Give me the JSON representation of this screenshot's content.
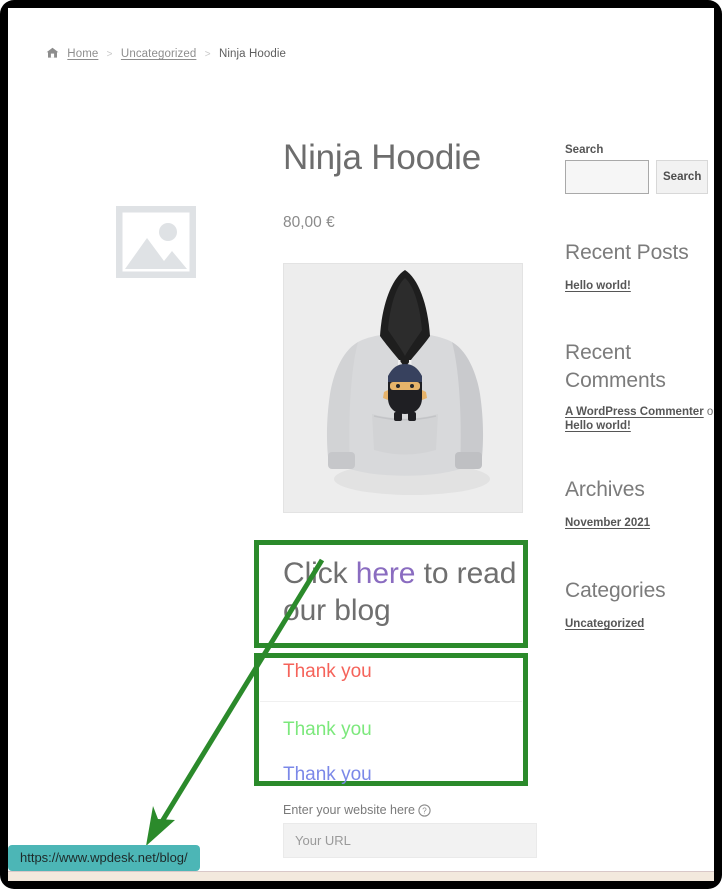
{
  "breadcrumb": {
    "home_icon": "home-icon",
    "items": [
      {
        "label": "Home",
        "link": true
      },
      {
        "label": "Uncategorized",
        "link": true
      },
      {
        "label": "Ninja Hoodie",
        "link": false
      }
    ],
    "separator": ">"
  },
  "product": {
    "title": "Ninja Hoodie",
    "price": "80,00 €",
    "gallery_placeholder_icon": "image-placeholder-icon",
    "photo_alt": "ninja-hoodie-photo"
  },
  "blog_cta": {
    "text_before": "Click ",
    "link_text": "here",
    "text_after": " to read our blog",
    "link_color": "#8a6cc0"
  },
  "thanks": [
    {
      "text": "Thank you",
      "color": "#f5635a"
    },
    {
      "text": "Thank you",
      "color": "#7ce87c"
    },
    {
      "text": "Thank you",
      "color": "#7b88e8"
    }
  ],
  "website_form": {
    "label": "Enter your website here",
    "help_icon": "help-circle-icon",
    "input_value": "",
    "input_placeholder": "Your URL"
  },
  "sidebar": {
    "search": {
      "label": "Search",
      "input_value": "",
      "input_placeholder": "",
      "button_label": "Search"
    },
    "recent_posts": {
      "heading": "Recent Posts",
      "items": [
        "Hello world!"
      ]
    },
    "recent_comments": {
      "heading": "Recent Comments",
      "author": "A WordPress Commenter",
      "connector": " on ",
      "post": "Hello world!"
    },
    "archives": {
      "heading": "Archives",
      "items": [
        "November 2021"
      ]
    },
    "categories": {
      "heading": "Categories",
      "items": [
        "Uncategorized"
      ]
    }
  },
  "annotations": {
    "box_color": "#2b8a2b",
    "arrow_color": "#2b8a2b",
    "arrow_icon": "arrow-pointer"
  },
  "status_bar": {
    "url": "https://www.wpdesk.net/blog/",
    "background": "#4cb6b6"
  }
}
